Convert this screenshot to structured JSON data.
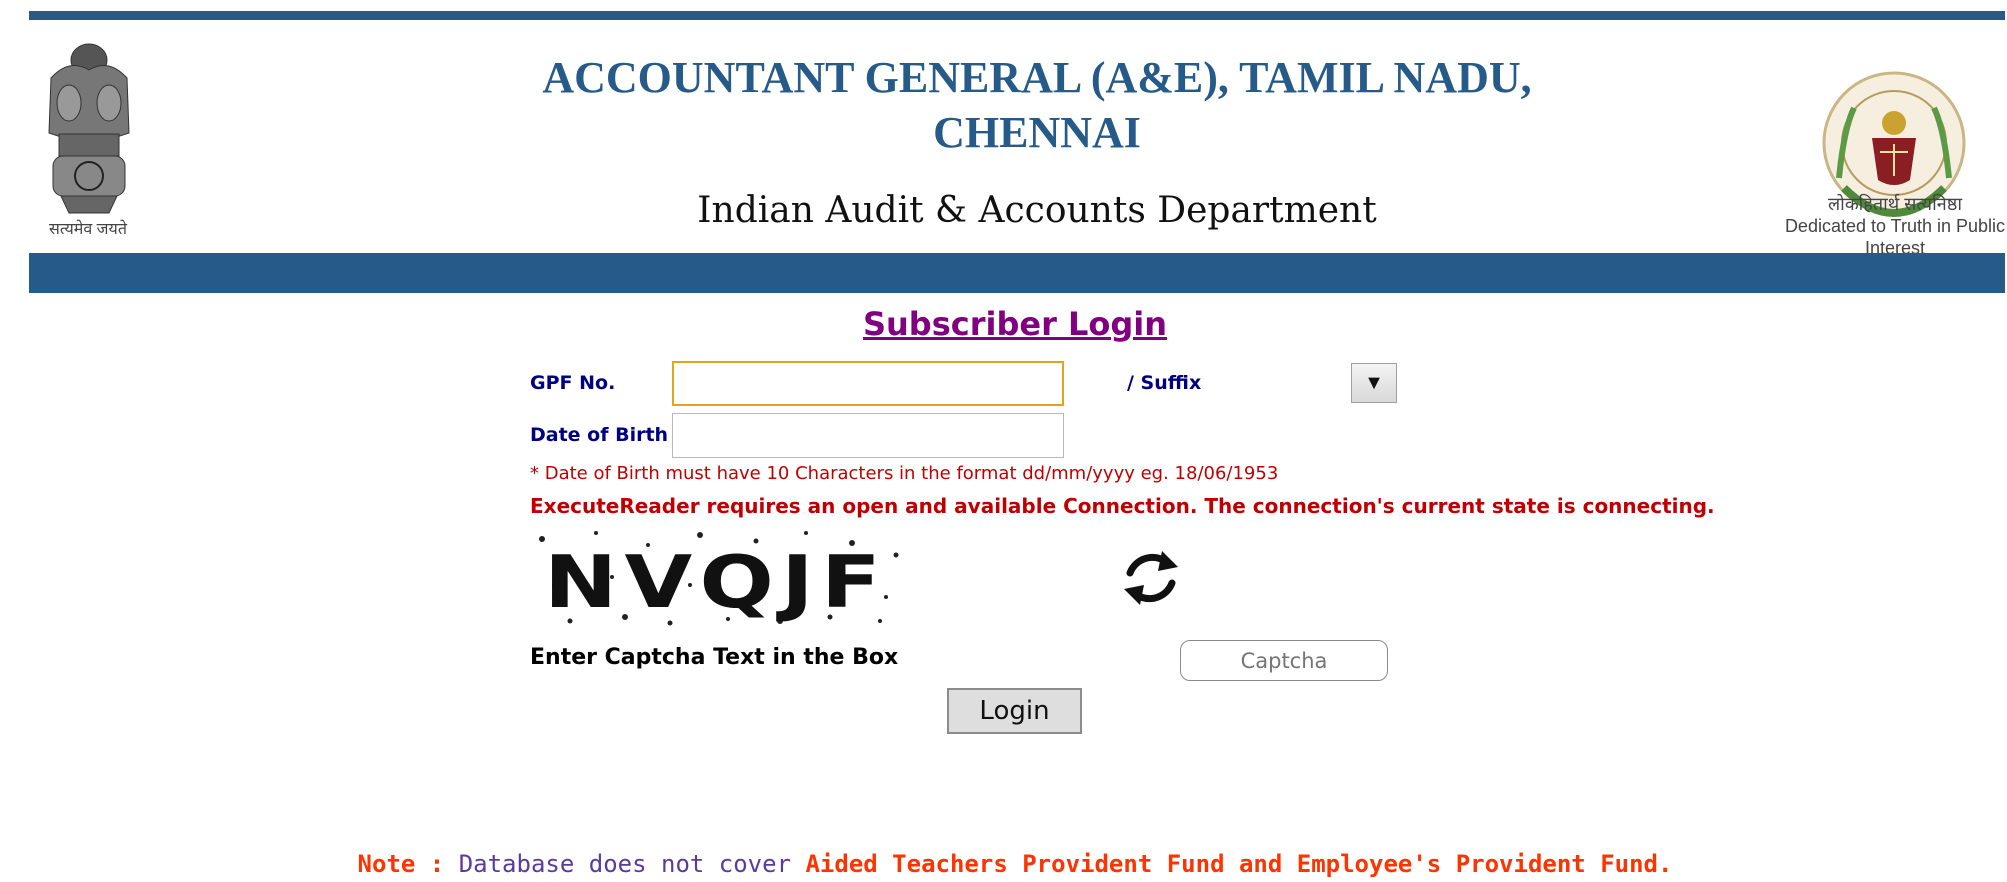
{
  "header": {
    "title_line1": "ACCOUNTANT GENERAL (A&E), TAMIL NADU,",
    "title_line2": "CHENNAI",
    "subtitle": "Indian Audit & Accounts Department",
    "left_motto": "सत्यमेव जयते",
    "right_motto_hindi": "लोकहितार्थ सत्यनिष्ठा",
    "right_motto_english": "Dedicated to Truth in Public Interest"
  },
  "login": {
    "title": "Subscriber Login",
    "gpf_label": "GPF No.",
    "gpf_value": "",
    "suffix_label": "/ Suffix",
    "suffix_arrow": "▼",
    "dob_label": "Date of Birth",
    "dob_value": "",
    "dob_hint": "* Date of Birth must have 10 Characters in the format dd/mm/yyyy eg. 18/06/1953",
    "error_message": "ExecuteReader requires an open and available Connection. The connection's current state is connecting.",
    "captcha_text": "NVQJF",
    "captcha_label": "Enter Captcha Text in the Box",
    "captcha_placeholder": "Captcha",
    "login_button": "Login"
  },
  "note": {
    "lead": "Note :",
    "middle": " Database does not cover ",
    "tail": "Aided Teachers Provident Fund and Employee's Provident Fund."
  },
  "colors": {
    "brand_blue": "#265a89",
    "login_title": "#800080",
    "label_navy": "#000080",
    "error_red": "#c00000",
    "note_red": "#ff3300",
    "focus_border": "#e5a31c"
  }
}
